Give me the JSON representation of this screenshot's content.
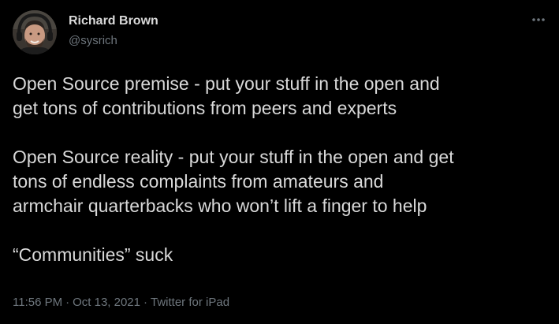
{
  "author": {
    "name": "Richard Brown",
    "handle": "@sysrich",
    "avatar_icon": "profile-avatar"
  },
  "more_icon": "more-dots-icon",
  "tweet": {
    "lines": [
      "Open Source premise - put your stuff in the open and",
      "get tons of contributions from peers and experts",
      "Open Source reality - put your stuff in the open and get",
      "tons of endless complaints from amateurs and",
      "armchair quarterbacks who won’t lift a finger to help",
      "“Communities” suck"
    ]
  },
  "meta": {
    "time": "11:56 PM",
    "date": "Oct 13, 2021",
    "source": "Twitter for iPad",
    "separator": "·"
  },
  "colors": {
    "background": "#000000",
    "text": "#d9d9d9",
    "secondary": "#6e767d"
  }
}
